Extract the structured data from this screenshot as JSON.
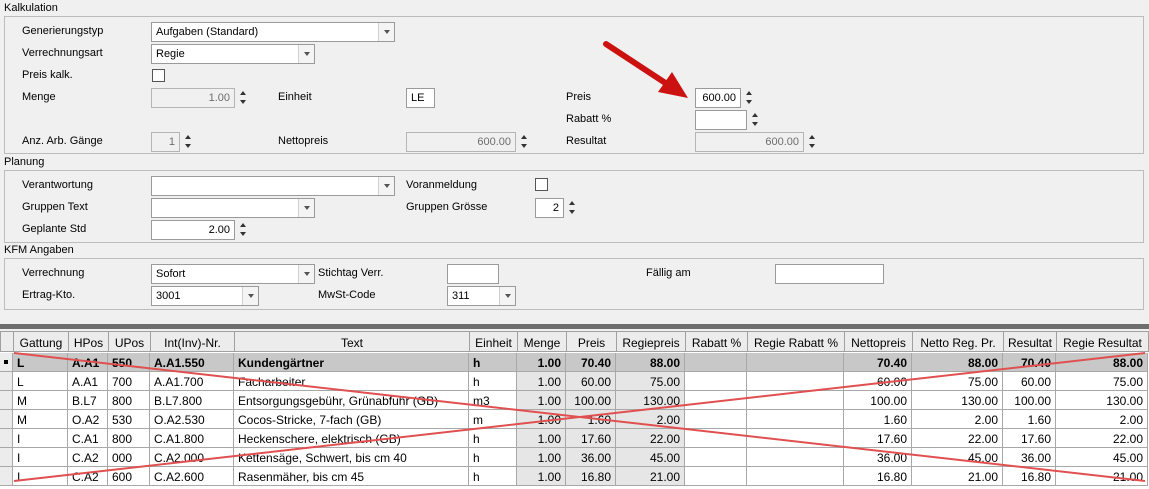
{
  "kalkulation": {
    "title": "Kalkulation",
    "generierungstyp_label": "Generierungstyp",
    "generierungstyp_value": "Aufgaben (Standard)",
    "verrechnungsart_label": "Verrechnungsart",
    "verrechnungsart_value": "Regie",
    "preis_kalk_label": "Preis kalk.",
    "menge_label": "Menge",
    "menge_value": "1.00",
    "einheit_label": "Einheit",
    "einheit_value": "LE",
    "preis_label": "Preis",
    "preis_value": "600.00",
    "rabatt_label": "Rabatt %",
    "rabatt_value": "",
    "anz_label": "Anz. Arb. Gänge",
    "anz_value": "1",
    "nettopreis_label": "Nettopreis",
    "nettopreis_value": "600.00",
    "resultat_label": "Resultat",
    "resultat_value": "600.00"
  },
  "planung": {
    "title": "Planung",
    "verantwortung_label": "Verantwortung",
    "verantwortung_value": "",
    "gruppen_text_label": "Gruppen Text",
    "gruppen_text_value": "",
    "geplante_std_label": "Geplante Std",
    "geplante_std_value": "2.00",
    "voranmeldung_label": "Voranmeldung",
    "gruppen_groesse_label": "Gruppen Grösse",
    "gruppen_groesse_value": "2"
  },
  "kfm": {
    "title": "KFM Angaben",
    "verrechnung_label": "Verrechnung",
    "verrechnung_value": "Sofort",
    "stichtag_label": "Stichtag Verr.",
    "stichtag_value": "",
    "faellig_label": "Fällig am",
    "faellig_value": "",
    "ertrag_label": "Ertrag-Kto.",
    "ertrag_value": "3001",
    "mwst_label": "MwSt-Code",
    "mwst_value": "311"
  },
  "grid": {
    "columns": [
      "Gattung",
      "HPos",
      "UPos",
      "Int(Inv)-Nr.",
      "Text",
      "Einheit",
      "Menge",
      "Preis",
      "Regiepreis",
      "Rabatt %",
      "Regie Rabatt %",
      "Nettopreis",
      "Netto Reg. Pr.",
      "Resultat",
      "Regie Resultat"
    ],
    "rows": [
      [
        "L",
        "A.A1",
        "550",
        "A.A1.550",
        "Kundengärtner",
        "h",
        "1.00",
        "70.40",
        "88.00",
        "",
        "",
        "70.40",
        "88.00",
        "70.40",
        "88.00"
      ],
      [
        "L",
        "A.A1",
        "700",
        "A.A1.700",
        "Facharbeiter",
        "h",
        "1.00",
        "60.00",
        "75.00",
        "",
        "",
        "60.00",
        "75.00",
        "60.00",
        "75.00"
      ],
      [
        "M",
        "B.L7",
        "800",
        "B.L7.800",
        "Entsorgungsgebühr, Grünabfuhr (GB)",
        "m3",
        "1.00",
        "100.00",
        "130.00",
        "",
        "",
        "100.00",
        "130.00",
        "100.00",
        "130.00"
      ],
      [
        "M",
        "O.A2",
        "530",
        "O.A2.530",
        "Cocos-Stricke, 7-fach (GB)",
        "m",
        "1.00",
        "1.60",
        "2.00",
        "",
        "",
        "1.60",
        "2.00",
        "1.60",
        "2.00"
      ],
      [
        "I",
        "C.A1",
        "800",
        "C.A1.800",
        "Heckenschere, elektrisch (GB)",
        "h",
        "1.00",
        "17.60",
        "22.00",
        "",
        "",
        "17.60",
        "22.00",
        "17.60",
        "22.00"
      ],
      [
        "I",
        "C.A2",
        "000",
        "C.A2.000",
        "Kettensäge, Schwert, bis cm 40",
        "h",
        "1.00",
        "36.00",
        "45.00",
        "",
        "",
        "36.00",
        "45.00",
        "36.00",
        "45.00"
      ],
      [
        "I",
        "C.A2",
        "600",
        "C.A2.600",
        "Rasenmäher, bis cm 45",
        "h",
        "1.00",
        "16.80",
        "21.00",
        "",
        "",
        "16.80",
        "21.00",
        "16.80",
        "21.00"
      ]
    ]
  },
  "colors": {
    "arrow": "#cc1111",
    "cross": "#e05050",
    "row_selected": "#c8c8c8",
    "row_alt": "#e6e6e6",
    "row_plain": "#ffffff"
  }
}
